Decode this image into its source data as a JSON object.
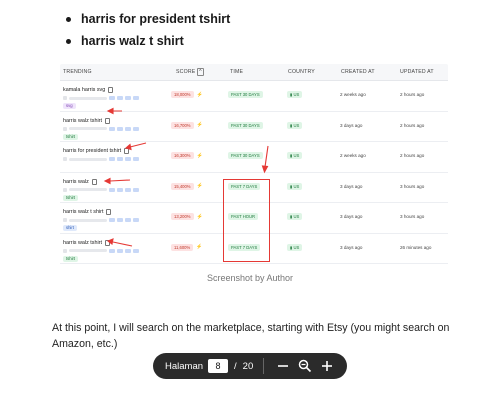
{
  "bullets": [
    "harris for president tshirt",
    "harris walz t shirt"
  ],
  "table": {
    "headers": [
      "TRENDING",
      "SCORE",
      "TIME",
      "COUNTRY",
      "CREATED AT",
      "UPDATED AT"
    ],
    "sort_indicator": "^",
    "rows": [
      {
        "keyword": "kamala harris svg",
        "tag": "svg",
        "tag_color": "purple",
        "score": "18,000%",
        "time": "PAST 30 DAYS",
        "country": "US",
        "created": "2 weeks ago",
        "updated": "2 hours ago"
      },
      {
        "keyword": "harris walz tshirt",
        "tag": "tshirt",
        "tag_color": "green",
        "score": "16,700%",
        "time": "PAST 30 DAYS",
        "country": "US",
        "created": "3 days ago",
        "updated": "2 hours ago"
      },
      {
        "keyword": "harris for president tshirt",
        "tag": "",
        "tag_color": "",
        "score": "16,300%",
        "time": "PAST 30 DAYS",
        "country": "US",
        "created": "2 weeks ago",
        "updated": "2 hours ago"
      },
      {
        "keyword": "harris walz",
        "tag": "tshirt",
        "tag_color": "green",
        "score": "15,400%",
        "time": "PAST 7 DAYS",
        "country": "US",
        "created": "3 days ago",
        "updated": "3 hours ago"
      },
      {
        "keyword": "harris walz t shirt",
        "tag": "shirt",
        "tag_color": "blue",
        "score": "13,200%",
        "time": "PAST HOUR",
        "country": "US",
        "created": "3 days ago",
        "updated": "3 hours ago"
      },
      {
        "keyword": "harris walz tshirt",
        "tag": "tshirt",
        "tag_color": "green",
        "score": "11,600%",
        "time": "PAST 7 DAYS",
        "country": "US",
        "created": "3 days ago",
        "updated": "26 minutes ago"
      }
    ]
  },
  "caption": "Screenshot by Author",
  "paragraph": "At this point, I will search on the marketplace, starting with Etsy (you might search on Amazon, etc.)",
  "pager": {
    "label": "Halaman",
    "current_page": "8",
    "separator": "/",
    "total_pages": "20"
  },
  "icons": {
    "zoom_out": "minus-icon",
    "zoom": "magnifier-icon",
    "zoom_in": "plus-icon"
  },
  "colors": {
    "arrow": "#e53935",
    "pager_bg": "#2b2b2b"
  }
}
